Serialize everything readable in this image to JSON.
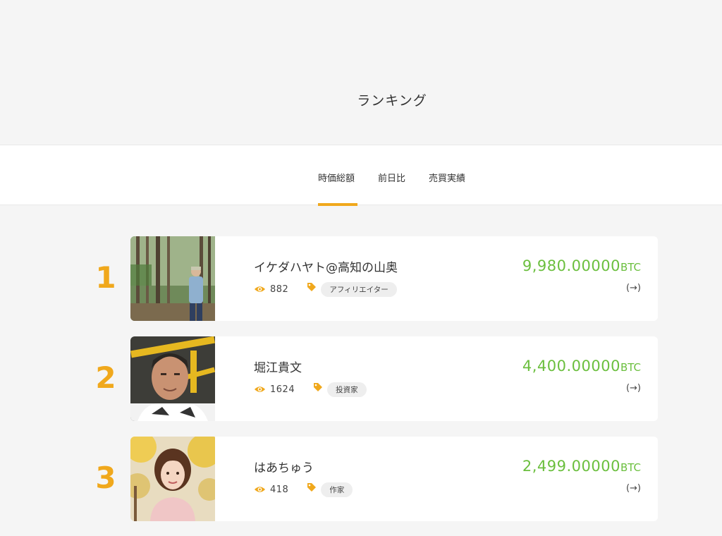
{
  "page": {
    "title": "ランキング"
  },
  "tabs": [
    {
      "label": "時価総額",
      "active": true
    },
    {
      "label": "前日比",
      "active": false
    },
    {
      "label": "売買実績",
      "active": false
    }
  ],
  "colors": {
    "accent": "#f0a81c",
    "price": "#6bbf3e",
    "background": "#f5f5f5"
  },
  "ranking": [
    {
      "rank": "1",
      "name": "イケダハヤト@高知の山奥",
      "views": "882",
      "tag": "アフィリエイター",
      "price": "9,980.00000",
      "unit": "BTC",
      "arrow": "(→)",
      "avatar_icon": "forest-person-photo"
    },
    {
      "rank": "2",
      "name": "堀江貴文",
      "views": "1624",
      "tag": "投資家",
      "price": "4,400.00000",
      "unit": "BTC",
      "arrow": "(→)",
      "avatar_icon": "man-portrait-photo"
    },
    {
      "rank": "3",
      "name": "はあちゅう",
      "views": "418",
      "tag": "作家",
      "price": "2,499.00000",
      "unit": "BTC",
      "arrow": "(→)",
      "avatar_icon": "woman-portrait-photo"
    }
  ]
}
